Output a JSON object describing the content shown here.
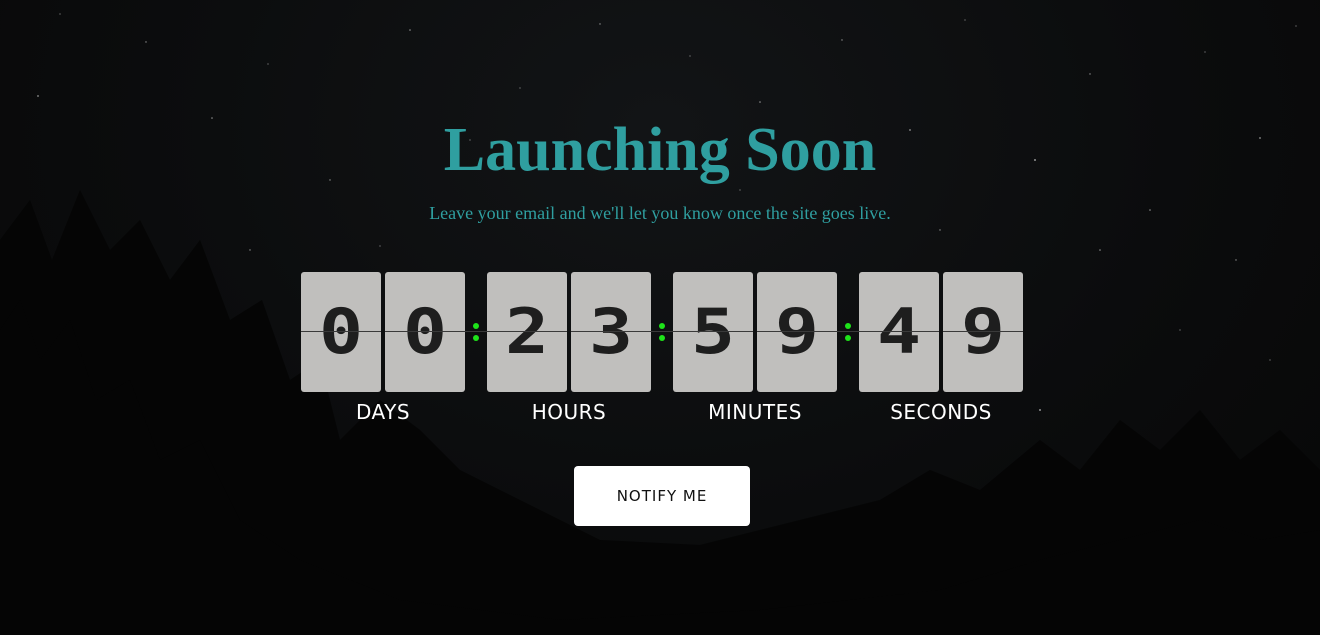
{
  "hero": {
    "title": "Launching Soon",
    "subtitle": "Leave your email and we'll let you know once the site goes live."
  },
  "countdown": {
    "days": {
      "d1": "0",
      "d2": "0",
      "label": "DAYS"
    },
    "hours": {
      "d1": "2",
      "d2": "3",
      "label": "HOURS"
    },
    "minutes": {
      "d1": "5",
      "d2": "9",
      "label": "MINUTES"
    },
    "seconds": {
      "d1": "4",
      "d2": "9",
      "label": "SECONDS"
    },
    "separator_color": "#1ee31a"
  },
  "cta": {
    "notify_label": "NOTIFY ME"
  },
  "colors": {
    "accent": "#2f9fa0",
    "card": "#c0bfbd",
    "background": "#0a0a0b"
  }
}
